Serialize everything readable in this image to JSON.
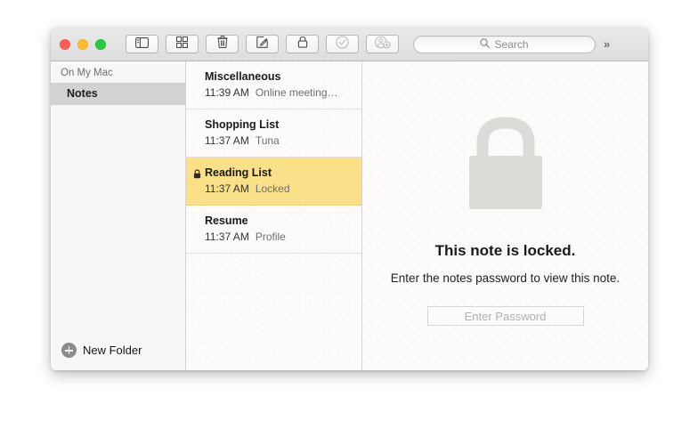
{
  "window": {
    "traffic_lights": [
      {
        "name": "close",
        "color": "#ff5f57"
      },
      {
        "name": "minimize",
        "color": "#febc2e"
      },
      {
        "name": "zoom",
        "color": "#28c840"
      }
    ]
  },
  "toolbar": {
    "buttons": [
      {
        "name": "sidebar-toggle",
        "icon": "sidebar-icon",
        "enabled": true
      },
      {
        "name": "gallery-view",
        "icon": "grid-icon",
        "enabled": true
      },
      {
        "name": "delete-note",
        "icon": "trash-icon",
        "enabled": true
      },
      {
        "name": "compose-note",
        "icon": "compose-icon",
        "enabled": true
      },
      {
        "name": "lock-note",
        "icon": "lock-icon",
        "enabled": true
      },
      {
        "name": "checklist",
        "icon": "check-circle-icon",
        "enabled": false
      },
      {
        "name": "add-people",
        "icon": "add-person-icon",
        "enabled": false
      }
    ],
    "search": {
      "placeholder": "Search",
      "icon": "search-icon"
    },
    "overflow": "»"
  },
  "sidebar": {
    "header": "On My Mac",
    "items": [
      {
        "label": "Notes",
        "selected": true
      }
    ],
    "footer": {
      "label": "New Folder",
      "icon": "plus-circle-icon"
    }
  },
  "notes_list": [
    {
      "title": "Miscellaneous",
      "time": "11:39 AM",
      "snippet": "Online meeting…",
      "locked": false,
      "selected": false
    },
    {
      "title": "Shopping List",
      "time": "11:37 AM",
      "snippet": "Tuna",
      "locked": false,
      "selected": false
    },
    {
      "title": "Reading List",
      "time": "11:37 AM",
      "snippet": "Locked",
      "locked": true,
      "selected": true
    },
    {
      "title": "Resume",
      "time": "11:37 AM",
      "snippet": "Profile",
      "locked": false,
      "selected": false
    }
  ],
  "detail": {
    "lock_icon": "large-lock-icon",
    "title": "This note is locked.",
    "subtitle": "Enter the notes password to view this note.",
    "password_placeholder": "Enter Password"
  },
  "colors": {
    "selected_note": "#fae089",
    "sidebar_selection": "#d2d2d2",
    "paper": "#fcfbf9"
  }
}
